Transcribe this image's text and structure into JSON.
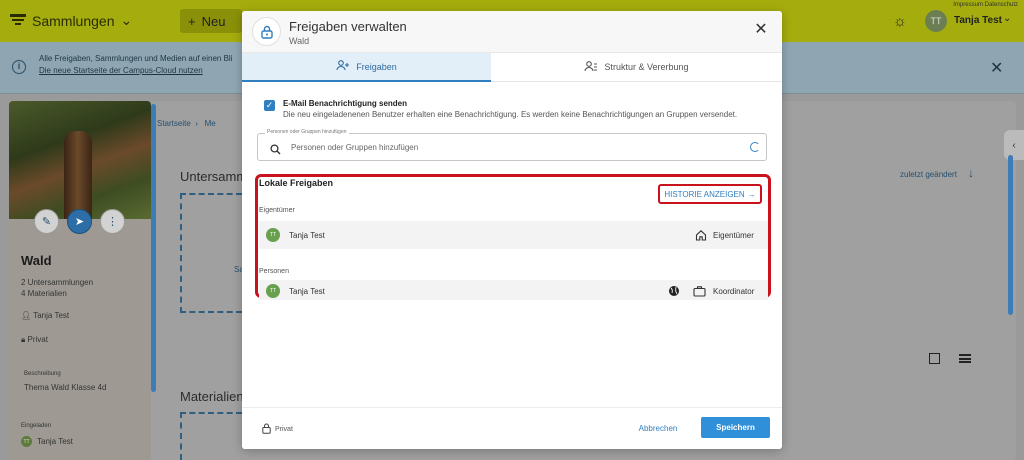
{
  "topbar": {
    "collections_label": "Sammlungen",
    "new_label": "Neu",
    "impressum": "Impressum",
    "datenschutz": "Datenschutz",
    "user_initials": "TT",
    "user_name": "Tanja Test"
  },
  "infobar": {
    "line1": "Alle Freigaben, Sammlungen und Medien auf einen Bli",
    "line2": "Die neue Startseite der Campus-Cloud nutzen"
  },
  "background": {
    "breadcrumb_start": "Startseite",
    "breadcrumb_next": "Me",
    "subcollections_title": "Untersamm",
    "dropzone_text": "Sa",
    "materials_title": "Materialien",
    "sort_label": "zuletzt geändert"
  },
  "collection": {
    "name": "Wald",
    "subcollections": "2 Untersammlungen",
    "materials": "4 Materialien",
    "owner": "Tanja Test",
    "visibility": "Privat",
    "description_label": "Beschreibung",
    "description": "Thema Wald Klasse 4d",
    "invited_label": "Eingeladen",
    "invited_initials": "TT",
    "invited_name": "Tanja Test"
  },
  "dialog": {
    "title": "Freigaben verwalten",
    "subtitle": "Wald",
    "tabs": [
      {
        "label": "Freigaben",
        "active": true
      },
      {
        "label": "Struktur & Vererbung",
        "active": false
      }
    ],
    "email": {
      "checked": true,
      "title": "E-Mail Benachrichtigung senden",
      "description": "Die neu eingeladenenen Benutzer erhalten eine Benachrichtigung. Es werden keine Benachrichtigungen an Gruppen versendet."
    },
    "search": {
      "label": "Personen oder Gruppen hinzufügen",
      "placeholder": "Personen oder Gruppen hinzufügen"
    },
    "local_shares": {
      "title": "Lokale Freigaben",
      "history_button": "HISTORIE ANZEIGEN",
      "owner_group_label": "Eigentümer",
      "owner": {
        "initials": "TT",
        "name": "Tanja Test",
        "role": "Eigentümer"
      },
      "persons_group_label": "Personen",
      "persons": [
        {
          "initials": "TT",
          "name": "Tanja Test",
          "role": "Koordinator"
        }
      ]
    },
    "footer": {
      "visibility": "Privat",
      "cancel_label": "Abbrechen",
      "save_label": "Speichern"
    }
  },
  "colors": {
    "accent": "#2f7fc1",
    "highlight_red": "#c8131c",
    "topbar": "#a4ad0d",
    "avatar_green": "#68a04d"
  }
}
